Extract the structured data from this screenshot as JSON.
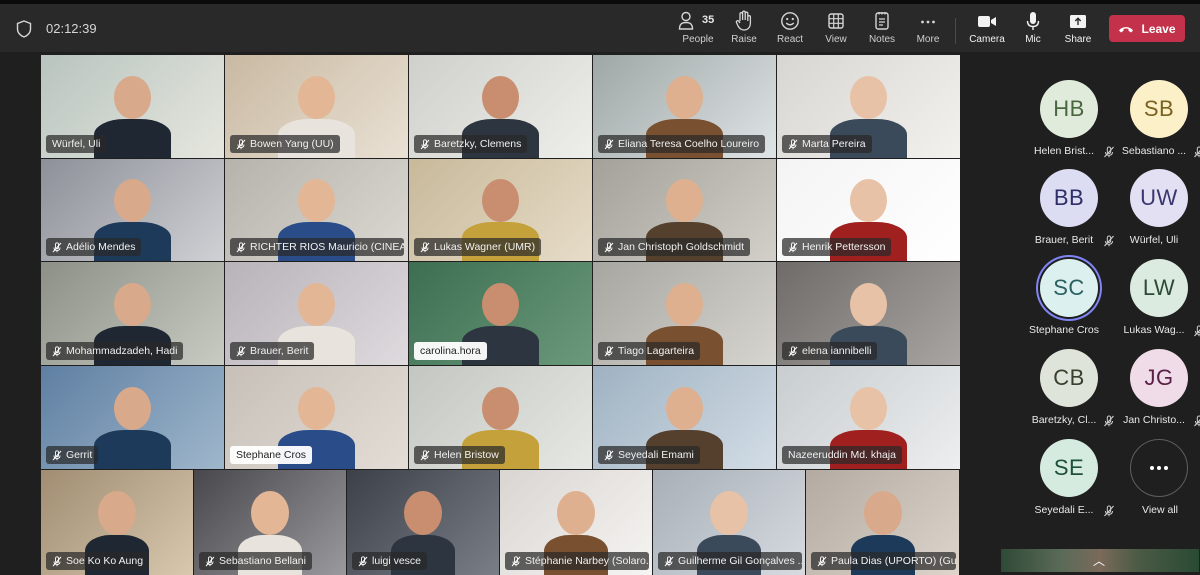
{
  "toolbar": {
    "timer": "02:12:39",
    "shield_icon": "shield-icon",
    "buttons": [
      {
        "id": "people",
        "label": "People",
        "icon": "people-icon",
        "count": "35"
      },
      {
        "id": "raise",
        "label": "Raise",
        "icon": "hand-icon"
      },
      {
        "id": "react",
        "label": "React",
        "icon": "smiley-icon"
      },
      {
        "id": "view",
        "label": "View",
        "icon": "grid-icon"
      },
      {
        "id": "notes",
        "label": "Notes",
        "icon": "notes-icon"
      },
      {
        "id": "more",
        "label": "More",
        "icon": "ellipsis-icon"
      },
      {
        "id": "camera",
        "label": "Camera",
        "icon": "camera-icon"
      },
      {
        "id": "mic",
        "label": "Mic",
        "icon": "mic-icon"
      },
      {
        "id": "share",
        "label": "Share",
        "icon": "share-icon"
      }
    ],
    "leave": {
      "label": "Leave",
      "icon": "phone-hangup-icon",
      "color": "#c4314b"
    }
  },
  "video_tiles": [
    {
      "name": "Würfel, Uli",
      "muted": false,
      "light": false
    },
    {
      "name": "Bowen Yang (UU)",
      "muted": true,
      "light": false
    },
    {
      "name": "Baretzky, Clemens",
      "muted": true,
      "light": false
    },
    {
      "name": "Eliana Teresa Coelho Loureiro",
      "muted": true,
      "light": false
    },
    {
      "name": "Marta Pereira",
      "muted": true,
      "light": false
    },
    {
      "name": "Adélio Mendes",
      "muted": true,
      "light": false
    },
    {
      "name": "RICHTER RIOS Mauricio (CINEA)",
      "muted": true,
      "light": false
    },
    {
      "name": "Lukas Wagner (UMR)",
      "muted": true,
      "light": false
    },
    {
      "name": "Jan Christoph Goldschmidt",
      "muted": true,
      "light": false
    },
    {
      "name": "Henrik Pettersson",
      "muted": true,
      "light": false
    },
    {
      "name": "Mohammadzadeh, Hadi",
      "muted": true,
      "light": false
    },
    {
      "name": "Brauer, Berit",
      "muted": true,
      "light": false
    },
    {
      "name": "carolina.hora",
      "muted": false,
      "light": true
    },
    {
      "name": "Tiago Lagarteira",
      "muted": true,
      "light": false
    },
    {
      "name": "elena iannibelli",
      "muted": true,
      "light": false
    },
    {
      "name": "Gerrit",
      "muted": true,
      "light": false
    },
    {
      "name": "Stephane Cros",
      "muted": false,
      "light": true
    },
    {
      "name": "Helen Bristow",
      "muted": true,
      "light": false
    },
    {
      "name": "Seyedali Emami",
      "muted": true,
      "light": false
    },
    {
      "name": "Nazeeruddin Md. khaja",
      "muted": false,
      "light": false
    },
    {
      "name": "Soe Ko Ko Aung",
      "muted": true,
      "light": false
    },
    {
      "name": "Sebastiano Bellani",
      "muted": true,
      "light": false
    },
    {
      "name": "luigi vesce",
      "muted": true,
      "light": false
    },
    {
      "name": "Stéphanie Narbey (Solaro...",
      "muted": true,
      "light": false
    },
    {
      "name": "Guilherme Gil Gonçalves ...",
      "muted": true,
      "light": false
    },
    {
      "name": "Paula Dias (UPORTO) (Gu...",
      "muted": true,
      "light": false
    }
  ],
  "side_participants": [
    {
      "initials": "HB",
      "name": "Helen Brist...",
      "muted": true,
      "bg": "#e1ebdc",
      "fg": "#4a6840",
      "speaking": false
    },
    {
      "initials": "SB",
      "name": "Sebastiano ...",
      "muted": true,
      "bg": "#fbf0c8",
      "fg": "#7a6220",
      "speaking": false
    },
    {
      "initials": "BB",
      "name": "Brauer, Berit",
      "muted": true,
      "bg": "#dcdcf2",
      "fg": "#2e2e68",
      "speaking": false
    },
    {
      "initials": "UW",
      "name": "Würfel, Uli",
      "muted": false,
      "bg": "#e2e0f2",
      "fg": "#3a3670",
      "speaking": false
    },
    {
      "initials": "SC",
      "name": "Stephane Cros",
      "muted": false,
      "bg": "#dcf0f0",
      "fg": "#2a6060",
      "speaking": true
    },
    {
      "initials": "LW",
      "name": "Lukas Wag...",
      "muted": true,
      "bg": "#dcebe0",
      "fg": "#2c4a36",
      "speaking": false
    },
    {
      "initials": "CB",
      "name": "Baretzky, Cl...",
      "muted": true,
      "bg": "#dfe4da",
      "fg": "#38402e",
      "speaking": false
    },
    {
      "initials": "JG",
      "name": "Jan Christo...",
      "muted": true,
      "bg": "#f0dce8",
      "fg": "#5a2048",
      "speaking": false
    },
    {
      "initials": "SE",
      "name": "Seyedali E...",
      "muted": true,
      "bg": "#d6ebe0",
      "fg": "#1e5038",
      "speaking": false
    }
  ],
  "view_all": {
    "label": "View all",
    "icon": "ellipsis-icon"
  },
  "self_view": {
    "icon": "chevron-up-icon"
  }
}
